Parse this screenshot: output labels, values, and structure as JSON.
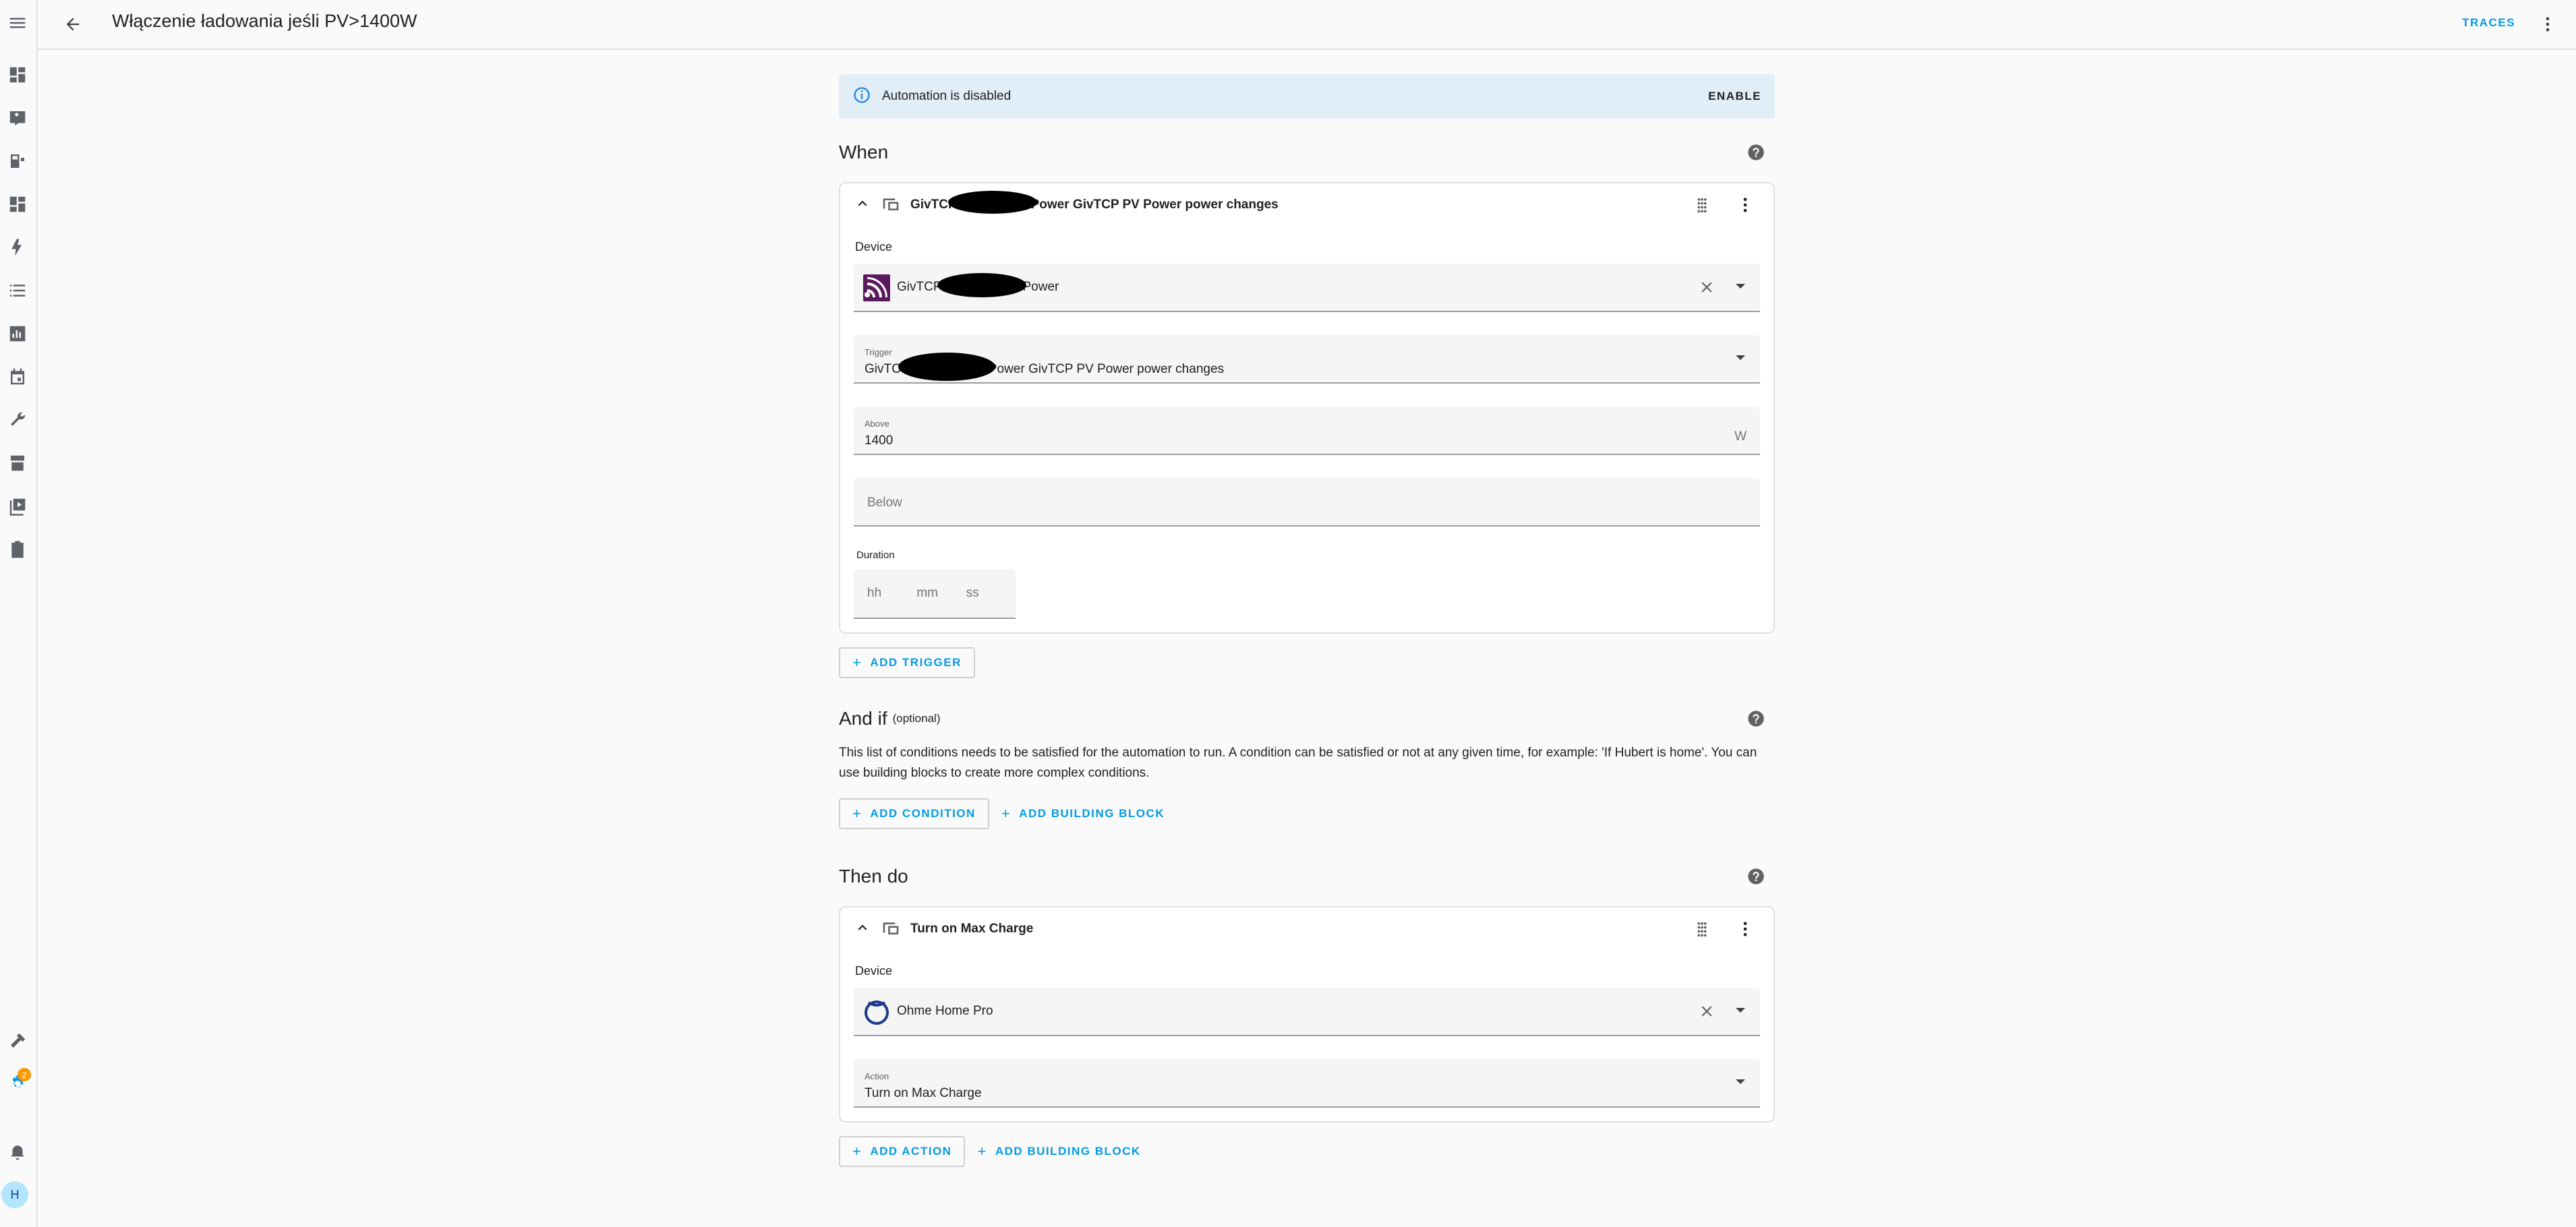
{
  "page": {
    "title": "Włączenie ładowania jeśli PV>1400W",
    "traces_label": "TRACES"
  },
  "sidebar": {
    "items": [
      "overview-icon",
      "map-icon",
      "energy-icon",
      "dashboard-icon",
      "lightning-icon",
      "logbook-icon",
      "history-icon",
      "calendar-icon",
      "wrench-icon",
      "store-icon",
      "media-icon",
      "todo-icon"
    ],
    "bottom_items": [
      "hammer-icon",
      "settings-icon",
      "bell-icon"
    ],
    "settings_badge": "2",
    "avatar_letter": "H"
  },
  "banner": {
    "text": "Automation is disabled",
    "action": "ENABLE"
  },
  "when": {
    "title": "When",
    "card": {
      "title_a": "GivTCP",
      "title_b": "Power GivTCP PV Power power changes",
      "device_label": "Device",
      "device_a": "GivTCP",
      "device_b": "Power",
      "trigger_label": "Trigger",
      "trigger_a": "GivTC",
      "trigger_b": "Power GivTCP PV Power power changes",
      "above_label": "Above",
      "above_value": "1400",
      "above_unit": "W",
      "below_placeholder": "Below",
      "duration_label": "Duration",
      "duration_hh": "hh",
      "duration_mm": "mm",
      "duration_ss": "ss"
    },
    "add_trigger": "ADD TRIGGER"
  },
  "andif": {
    "title": "And if",
    "optional": "(optional)",
    "description": "This list of conditions needs to be satisfied for the automation to run. A condition can be satisfied or not at any given time, for example: 'If Hubert is home'. You can use building blocks to create more complex conditions.",
    "add_condition": "ADD CONDITION",
    "add_building_block": "ADD BUILDING BLOCK"
  },
  "then": {
    "title": "Then do",
    "card": {
      "title": "Turn on Max Charge",
      "device_label": "Device",
      "device": "Ohme Home Pro",
      "action_label": "Action",
      "action_value": "Turn on Max Charge"
    },
    "add_action": "ADD ACTION",
    "add_building_block": "ADD BUILDING BLOCK"
  },
  "colors": {
    "accent": "#039be5",
    "banner_bg": "#e1edf7",
    "info_icon": "#1e88e5",
    "givtcp_logo": "#5b1a5e",
    "ohme_logo": "#1e3a8a",
    "badge": "#ff9800"
  }
}
